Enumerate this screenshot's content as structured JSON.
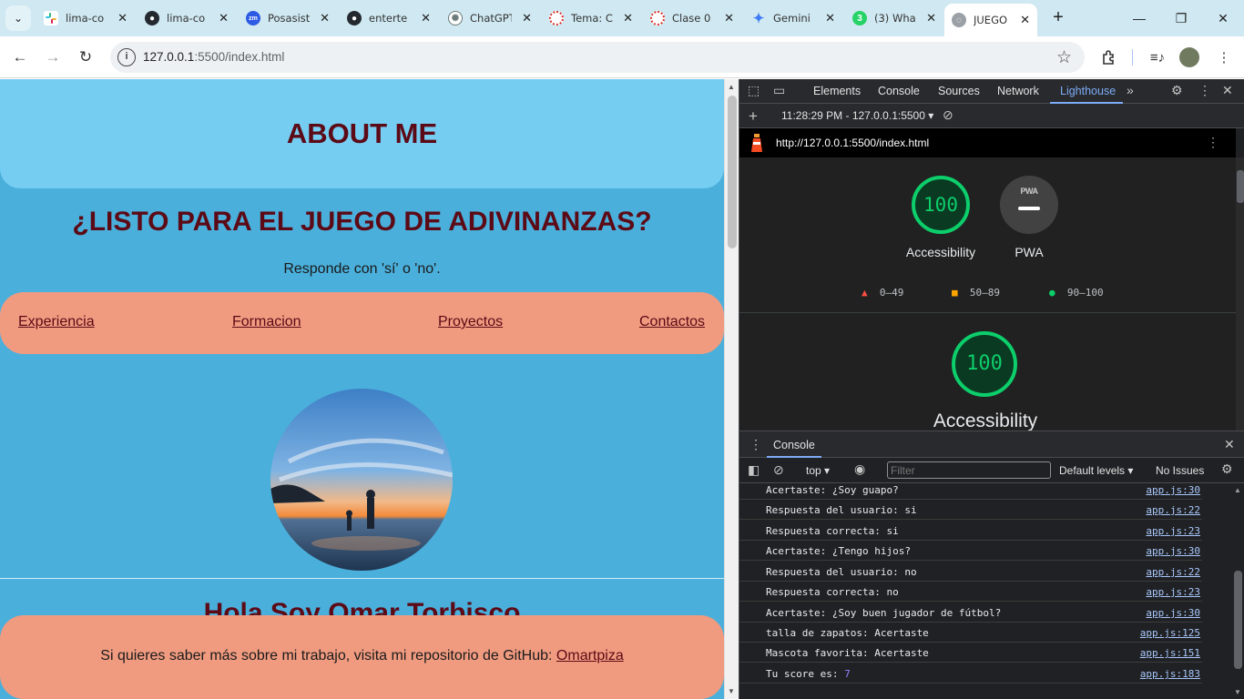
{
  "browser": {
    "tabs": [
      {
        "label": "lima-co",
        "icon": "slack-icon",
        "color": "#611f69"
      },
      {
        "label": "lima-co",
        "icon": "github-icon",
        "color": "#24292f"
      },
      {
        "label": "Posasist",
        "icon": "zoom-icon",
        "color": "#2d5be3"
      },
      {
        "label": "enterte",
        "icon": "github-icon",
        "color": "#24292f"
      },
      {
        "label": "ChatGPT",
        "icon": "chatgpt-icon",
        "color": "#6b7a7a"
      },
      {
        "label": "Tema: C",
        "icon": "moodle-icon",
        "color": "#d93025"
      },
      {
        "label": "Clase 0",
        "icon": "moodle-icon",
        "color": "#d93025"
      },
      {
        "label": "Gemini",
        "icon": "gemini-icon",
        "color": "#3c7bf6"
      },
      {
        "label": "(3) Wha",
        "icon": "whatsapp-icon",
        "color": "#25d366"
      },
      {
        "label": "JUEGO",
        "icon": "globe-icon",
        "color": "#777777"
      }
    ],
    "url_host": "127.0.0.1",
    "url_rest": ":5500/index.html"
  },
  "page": {
    "about_title": "ABOUT ME",
    "game_title": "¿LISTO PARA EL JUEGO DE ADIVINANZAS?",
    "game_sub": "Responde con 'sí' o 'no'.",
    "nav": [
      "Experiencia",
      "Formacion",
      "Proyectos",
      "Contactos"
    ],
    "hola": "Hola Soy Omar Torbisco",
    "footer_text": "Si quieres saber más sobre mi trabajo, visita mi repositorio de GitHub: ",
    "footer_link": "Omartpiza"
  },
  "devtools": {
    "tabs": [
      "Elements",
      "Console",
      "Sources",
      "Network",
      "Lighthouse"
    ],
    "active_tab": "Lighthouse",
    "report_select": "11:28:29 PM - 127.0.0.1:5500",
    "report_url": "http://127.0.0.1:5500/index.html",
    "gauge_score": "100",
    "gauge_label": "Accessibility",
    "pwa_label": "PWA",
    "pwa_badge": "PWA",
    "legend": [
      "0–49",
      "50–89",
      "90–100"
    ],
    "big_score": "100",
    "big_label": "Accessibility",
    "console_tab": "Console",
    "context": "top",
    "filter_placeholder": "Filter",
    "levels": "Default levels",
    "issues": "No Issues",
    "logs": [
      {
        "msg": "Acertaste: ¿Soy guapo?",
        "src": "app.js:30"
      },
      {
        "msg": "Respuesta del usuario: si",
        "src": "app.js:22"
      },
      {
        "msg": "Respuesta correcta: si",
        "src": "app.js:23"
      },
      {
        "msg": "Acertaste: ¿Tengo hijos?",
        "src": "app.js:30"
      },
      {
        "msg": "Respuesta del usuario: no",
        "src": "app.js:22"
      },
      {
        "msg": "Respuesta correcta: no",
        "src": "app.js:23"
      },
      {
        "msg": "Acertaste: ¿Soy buen jugador de fútbol?",
        "src": "app.js:30"
      },
      {
        "msg": "talla de zapatos: Acertaste",
        "src": "app.js:125"
      },
      {
        "msg": "Mascota favorita: Acertaste",
        "src": "app.js:151"
      },
      {
        "msg": "Tu score es: ",
        "num": "7",
        "src": "app.js:183"
      }
    ]
  }
}
